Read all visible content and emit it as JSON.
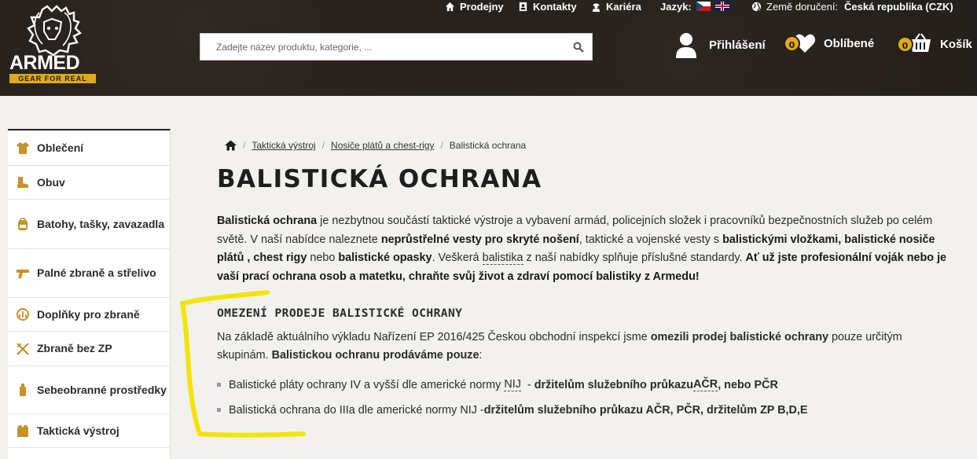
{
  "header": {
    "logo": {
      "name": "ARMED",
      "tagline": "GEAR FOR REAL"
    },
    "top_links": {
      "prodejny": "Prodejny",
      "kontakty": "Kontakty",
      "kariera": "Kariéra",
      "jazyk": "Jazyk:",
      "zeme_label": "Země doručení:",
      "zeme_value": "Česká republika (CZK)"
    },
    "search": {
      "placeholder": "Zadejte název produktu, kategorie, ..."
    },
    "login_label": "Přihlášení",
    "favorites": {
      "count": "0",
      "label": "Oblíbené"
    },
    "cart": {
      "count": "0",
      "label": "Košík"
    },
    "accent_color": "#e0a81a"
  },
  "sidebar": {
    "items": [
      {
        "label": "Oblečení",
        "icon": "jacket-icon"
      },
      {
        "label": "Obuv",
        "icon": "boot-icon"
      },
      {
        "label": "Batohy, tašky, zavazadla",
        "icon": "backpack-icon"
      },
      {
        "label": "Palné zbraně a střelivo",
        "icon": "pistol-icon"
      },
      {
        "label": "Doplňky pro zbraně",
        "icon": "scope-icon"
      },
      {
        "label": "Zbraně bez ZP",
        "icon": "crossbow-icon"
      },
      {
        "label": "Sebeobranné prostředky",
        "icon": "spray-icon"
      },
      {
        "label": "Taktická výstroj",
        "icon": "vest-icon"
      }
    ]
  },
  "breadcrumb": {
    "items": [
      "Taktická výstroj",
      "Nosiče plátů a chest-rigy",
      "Balistická ochrana"
    ]
  },
  "main": {
    "title": "BALISTICKÁ OCHRANA",
    "intro": {
      "b1": "Balistická ochrana",
      "t1": " je nezbytnou součástí taktické výstroje a vybavení armád, policejních složek i pracovníků bezpečnostních služeb po celém světě. V naší nabídce naleznete ",
      "b2": "neprůstřelné vesty pro skryté nošení",
      "t2": ", taktické a vojenské vesty s ",
      "b3": "balistickými vložkami, balistické nosiče plátů , chest rigy",
      "t3": " nebo ",
      "b4": "balistické opasky",
      "t4": ". Veškerá ",
      "u1": "balistika",
      "t5": " z naší nabídky splňuje příslušné standardy. ",
      "b5": "Ať už jste profesionální voják nebo je vaší prací ochrana osob a matetku, chraňte svůj život a zdraví pomocí balistiky z Armedu!"
    },
    "subheading": "OMEZENÍ PRODEJE BALISTICKÉ OCHRANY",
    "para2": {
      "t1": "Na základě aktuálního výkladu Nařízení EP 2016/425 Českou obchodní inspekcí jsme ",
      "b1": "omezili prodej balistické ochrany",
      "t2": " pouze určitým skupinám. ",
      "b2": "Balistickou ochranu prodáváme pouze",
      "t3": ":"
    },
    "bullets": [
      {
        "t1": "Balistické pláty ochrany IV a vyšší dle americké normy ",
        "u1": "NIJ",
        "t2": "  - ",
        "b1": "držitelům služebního průkazu ",
        "u2": "AČR",
        "b2": ", nebo PČR"
      },
      {
        "t1": "Balistická ochrana do IIIa dle americké normy NIJ - ",
        "b1": "držitelům služebního průkazu AČR, PČR, držitelům ZP B,D,E"
      }
    ]
  },
  "annotation": {
    "color": "#f5e400"
  }
}
